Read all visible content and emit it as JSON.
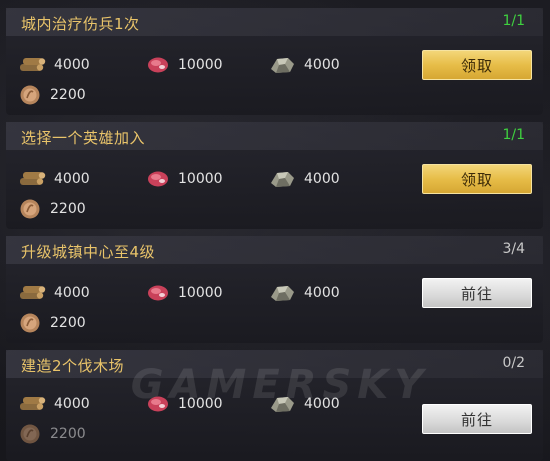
{
  "colors": {
    "title": "#e9c46a",
    "progress_done": "#3fd13f",
    "progress_todo": "#c9c9c9",
    "claim_button": "#e7bd48",
    "go_button": "#d9d9d9"
  },
  "resource_icons": [
    "wood-icon",
    "meat-icon",
    "stone-icon",
    "coin-icon"
  ],
  "quests": [
    {
      "title": "城内治疗伤兵1次",
      "progress": "1/1",
      "status": "done",
      "rewards": {
        "wood": "4000",
        "meat": "10000",
        "stone": "4000",
        "coin": "2200"
      },
      "button": "领取"
    },
    {
      "title": "选择一个英雄加入",
      "progress": "1/1",
      "status": "done",
      "rewards": {
        "wood": "4000",
        "meat": "10000",
        "stone": "4000",
        "coin": "2200"
      },
      "button": "领取"
    },
    {
      "title": "升级城镇中心至4级",
      "progress": "3/4",
      "status": "todo",
      "rewards": {
        "wood": "4000",
        "meat": "10000",
        "stone": "4000",
        "coin": "2200"
      },
      "button": "前往"
    },
    {
      "title": "建造2个伐木场",
      "progress": "0/2",
      "status": "todo",
      "rewards": {
        "wood": "4000",
        "meat": "10000",
        "stone": "4000",
        "coin": "2200"
      },
      "button": "前往"
    }
  ],
  "watermark": "GAMERSKY"
}
